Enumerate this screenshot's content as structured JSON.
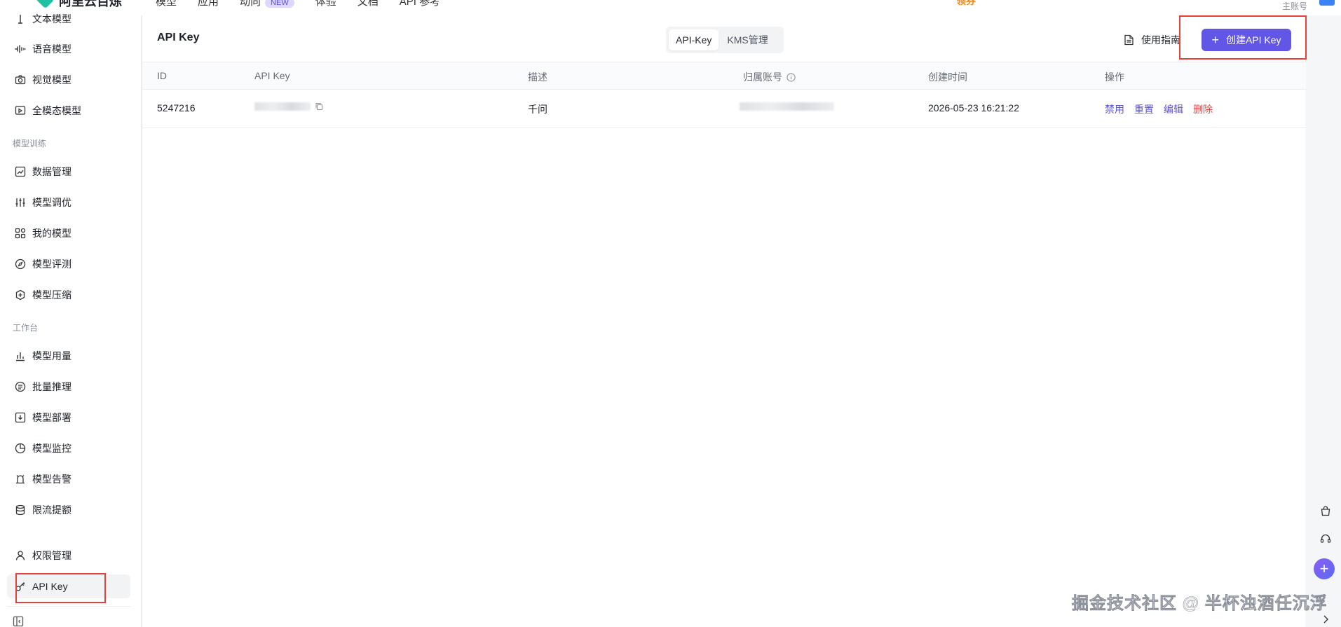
{
  "topbar": {
    "logo_text": "阿里云百炼",
    "nav": [
      {
        "label": "模型"
      },
      {
        "label": "应用"
      },
      {
        "label": "动向"
      },
      {
        "label": "体验"
      },
      {
        "label": "文档"
      },
      {
        "label": "API 参考"
      }
    ],
    "nav_badge": "NEW",
    "coupon": "领券",
    "account_label": "主账号"
  },
  "sidebar": {
    "items_top": [
      {
        "label": "文本模型",
        "icon": "text-cursor-icon"
      },
      {
        "label": "语音模型",
        "icon": "waveform-icon"
      },
      {
        "label": "视觉模型",
        "icon": "camera-icon"
      },
      {
        "label": "全模态模型",
        "icon": "multimodal-icon"
      }
    ],
    "group_training": "模型训练",
    "items_training": [
      {
        "label": "数据管理",
        "icon": "chart-line-icon"
      },
      {
        "label": "模型调优",
        "icon": "sliders-icon"
      },
      {
        "label": "我的模型",
        "icon": "grid-icon"
      },
      {
        "label": "模型评测",
        "icon": "compass-icon"
      },
      {
        "label": "模型压缩",
        "icon": "compress-icon"
      }
    ],
    "group_workbench": "工作台",
    "items_workbench": [
      {
        "label": "模型用量",
        "icon": "bar-chart-icon"
      },
      {
        "label": "批量推理",
        "icon": "list-icon"
      },
      {
        "label": "模型部署",
        "icon": "deploy-icon"
      },
      {
        "label": "模型监控",
        "icon": "pie-chart-icon"
      },
      {
        "label": "模型告警",
        "icon": "alarm-icon"
      },
      {
        "label": "限流提额",
        "icon": "database-icon"
      }
    ],
    "items_bottom": [
      {
        "label": "权限管理",
        "icon": "user-icon"
      },
      {
        "label": "API Key",
        "icon": "key-icon",
        "active": true
      }
    ]
  },
  "main": {
    "title": "API Key",
    "tabs": [
      {
        "label": "API-Key",
        "selected": true
      },
      {
        "label": "KMS管理",
        "selected": false
      }
    ],
    "guide_label": "使用指南",
    "create_label": "创建API Key",
    "table": {
      "headers": [
        "ID",
        "API Key",
        "描述",
        "归属账号",
        "创建时间",
        "操作"
      ],
      "rows": [
        {
          "id": "5247216",
          "description": "千问",
          "created_at": "2026-05-23 16:21:22",
          "actions": [
            "禁用",
            "重置",
            "编辑",
            "删除"
          ]
        }
      ]
    }
  },
  "colors": {
    "primary": "#6156e6",
    "danger": "#e54545",
    "highlight_box": "#e5413c"
  },
  "watermark": "掘金技术社区 @ 半杯浊酒任沉浮"
}
